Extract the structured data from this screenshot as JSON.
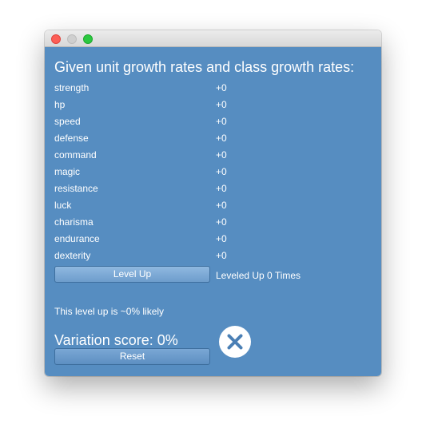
{
  "window": {
    "controls": [
      "close",
      "minimize",
      "zoom"
    ]
  },
  "heading": "Given unit growth rates and class growth rates:",
  "stats": [
    {
      "name": "strength",
      "value": "+0"
    },
    {
      "name": "hp",
      "value": "+0"
    },
    {
      "name": "speed",
      "value": "+0"
    },
    {
      "name": "defense",
      "value": "+0"
    },
    {
      "name": "command",
      "value": "+0"
    },
    {
      "name": "magic",
      "value": "+0"
    },
    {
      "name": "resistance",
      "value": "+0"
    },
    {
      "name": "luck",
      "value": "+0"
    },
    {
      "name": "charisma",
      "value": "+0"
    },
    {
      "name": "endurance",
      "value": "+0"
    },
    {
      "name": "dexterity",
      "value": "+0"
    }
  ],
  "level_up_button": "Level Up",
  "leveled_up_text": "Leveled Up 0 Times",
  "likelihood_text": "This level up is ~0% likely",
  "variation_text": "Variation score: 0%",
  "result_icon": "x-circle-icon",
  "reset_button": "Reset",
  "colors": {
    "background": "#568dc1",
    "text": "#ffffff",
    "icon_circle": "#ffffff",
    "icon_mark": "#4a7fb5"
  }
}
